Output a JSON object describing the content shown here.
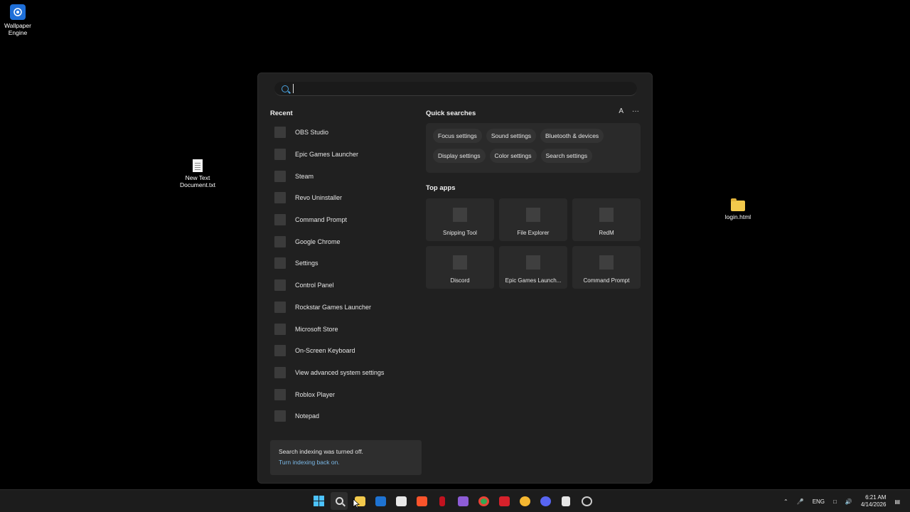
{
  "desktop": {
    "icons": [
      {
        "label_line1": "Wallpaper",
        "label_line2": "Engine",
        "icon": "wallpaper-engine-icon"
      },
      {
        "label_line1": "New Text",
        "label_line2": "Document.txt",
        "icon": "text-document-icon"
      },
      {
        "label_line1": "login.html",
        "label_line2": "",
        "icon": "folder-icon"
      }
    ]
  },
  "search": {
    "placeholder": "",
    "value": ""
  },
  "recent": {
    "title": "Recent",
    "items": [
      "OBS Studio",
      "Epic Games Launcher",
      "Steam",
      "Revo Uninstaller",
      "Command Prompt",
      "Google Chrome",
      "Settings",
      "Control Panel",
      "Rockstar Games Launcher",
      "Microsoft Store",
      "On-Screen Keyboard",
      "View advanced system settings",
      "Roblox Player",
      "Notepad"
    ]
  },
  "quick_searches": {
    "title": "Quick searches",
    "account_letter": "A",
    "more": "···",
    "row1": [
      "Focus settings",
      "Sound settings",
      "Bluetooth & devices"
    ],
    "row2": [
      "Display settings",
      "Color settings",
      "Search settings"
    ]
  },
  "top_apps": {
    "title": "Top apps",
    "items": [
      "Snipping Tool",
      "File Explorer",
      "RedM",
      "Discord",
      "Epic Games Launch...",
      "Command Prompt"
    ]
  },
  "indexing": {
    "message": "Search indexing was turned off.",
    "link": "Turn indexing back on."
  },
  "taskbar": {
    "language": "ENG",
    "time": "6:21 AM",
    "date": "4/14/2026",
    "colors": {
      "accent": "#4cc2ff"
    }
  }
}
